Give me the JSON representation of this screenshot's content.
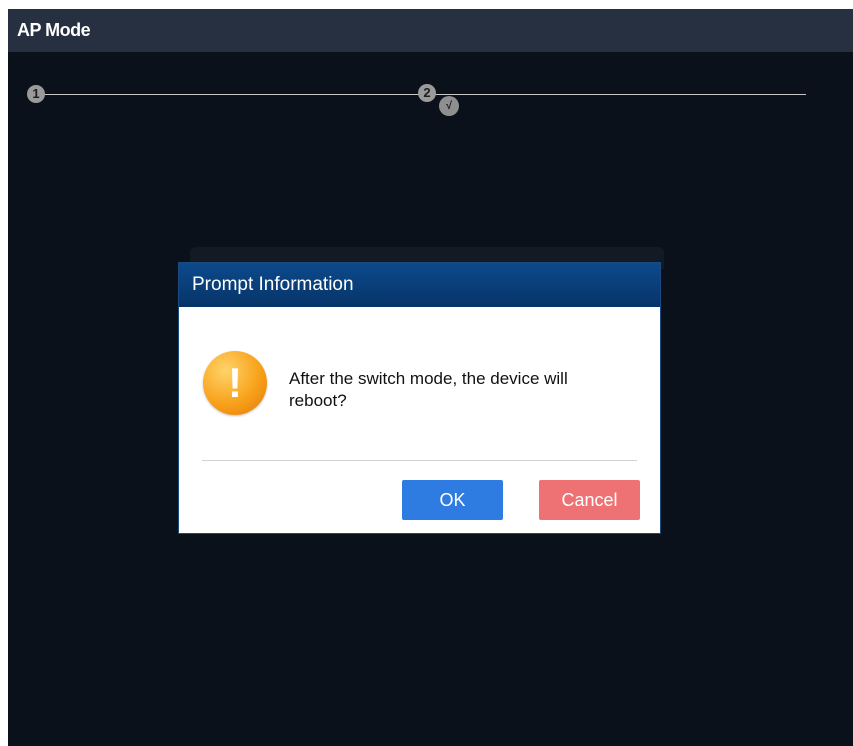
{
  "window": {
    "title": "AP Mode"
  },
  "steps": [
    {
      "label": "1"
    },
    {
      "label": "2"
    },
    {
      "label": "√"
    }
  ],
  "dialog": {
    "title": "Prompt Information",
    "icon": "warning-icon",
    "icon_glyph": "!",
    "message": "After the switch mode, the device will reboot?",
    "ok_label": "OK",
    "cancel_label": "Cancel"
  },
  "colors": {
    "background": "#0b111a",
    "titlebar": "#263040",
    "dialog_header": "#0d4a8c",
    "ok_button": "#2e7be2",
    "cancel_button": "#ee7174",
    "warning": "#f8a21b"
  }
}
